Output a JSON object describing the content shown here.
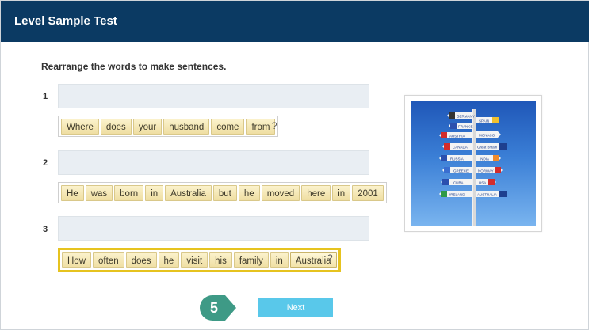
{
  "header": {
    "title": "Level Sample Test"
  },
  "instructions": "Rearrange the words to make sentences.",
  "questions": [
    {
      "number": "1",
      "words": [
        "Where",
        "does",
        "your",
        "husband",
        "come",
        "from"
      ],
      "punct": "?"
    },
    {
      "number": "2",
      "words": [
        "He",
        "was",
        "born",
        "in",
        "Australia",
        "but",
        "he",
        "moved",
        "here",
        "in",
        "2001"
      ],
      "punct": "."
    },
    {
      "number": "3",
      "words": [
        "How",
        "often",
        "does",
        "he",
        "visit",
        "his",
        "family",
        "in",
        "Australia"
      ],
      "punct": "?"
    }
  ],
  "signpost": {
    "signs": [
      "GERMANY",
      "SPAIN",
      "FRANCE",
      "AUSTRIA",
      "MONACO",
      "CANADA",
      "Great Britain",
      "RUSSIA",
      "INDIA",
      "GREECE",
      "NORWAY",
      "CUBA",
      "USA",
      "IRELAND",
      "AUSTRALIA"
    ]
  },
  "step": {
    "number": "5"
  },
  "next_button": {
    "label": "Next"
  },
  "colors": {
    "header": "#0b3a63",
    "next": "#59c8ea",
    "step_badge": "#3e9a86",
    "selected_border": "#e6c31f"
  }
}
